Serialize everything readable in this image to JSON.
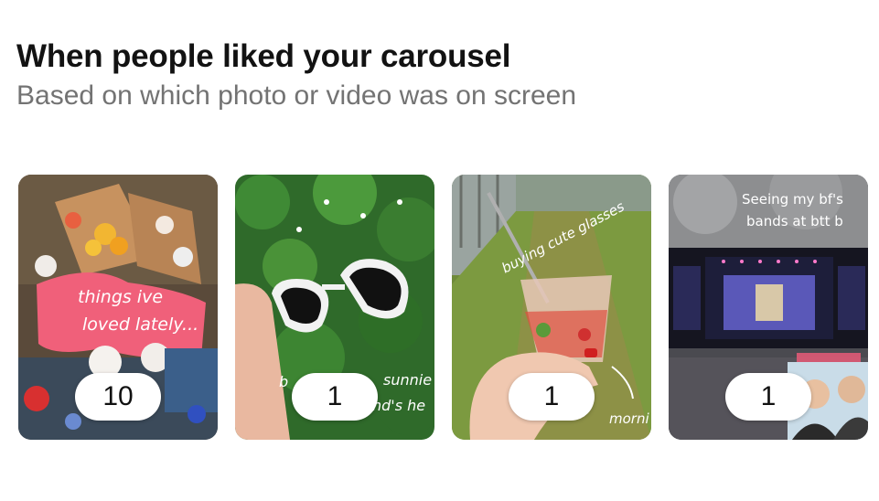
{
  "header": {
    "title": "When people liked your carousel",
    "subtitle": "Based on which photo or video was on screen"
  },
  "cards": [
    {
      "count": "10",
      "overlay": {
        "line1": "things ive",
        "line2": "loved lately..."
      }
    },
    {
      "count": "1",
      "overlay": {
        "right_line1": "sunnie",
        "right_line2": "nd's he",
        "left_fragment": "b"
      }
    },
    {
      "count": "1",
      "overlay": {
        "caption": "buying cute glasses",
        "bottom_right": "morni"
      }
    },
    {
      "count": "1",
      "overlay": {
        "line1": "Seeing my bf's",
        "line2": "bands at btt b"
      }
    }
  ],
  "colors": {
    "title": "#121212",
    "subtitle": "#737373",
    "pill_bg": "#ffffff",
    "overlay_pink": "#e8445e"
  }
}
